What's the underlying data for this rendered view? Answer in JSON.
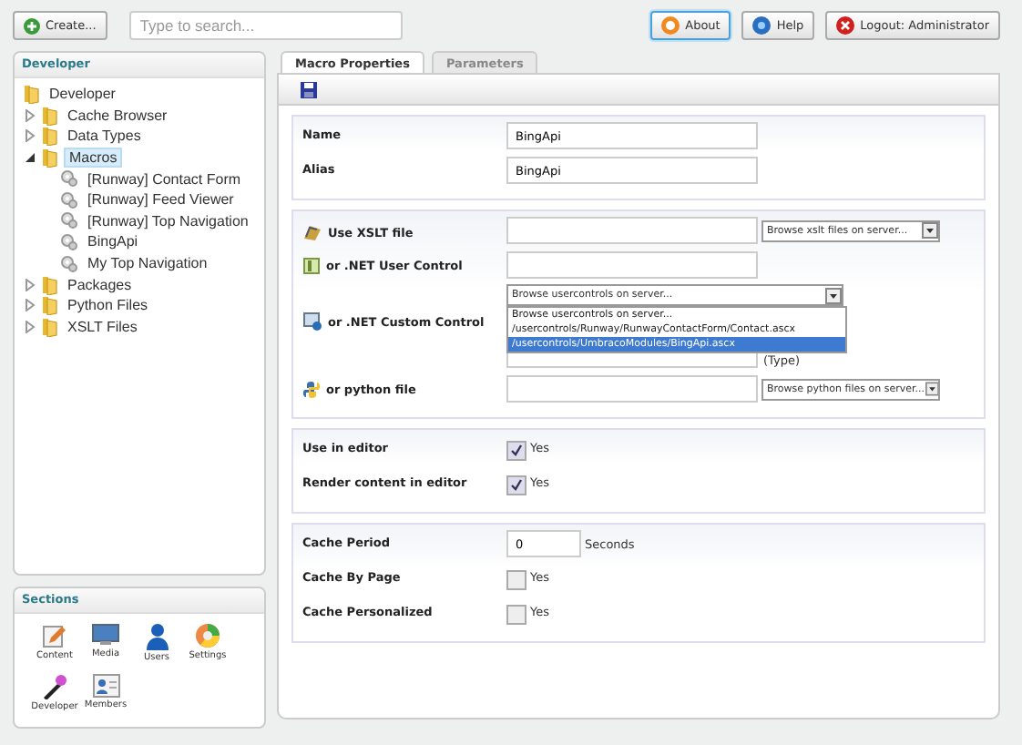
{
  "top_bar": {
    "create_button": "Create...",
    "search": {
      "placeholder": "Type to search..."
    },
    "buttons": [
      {
        "label": "About",
        "kind": "about",
        "selected": true
      },
      {
        "label": "Help",
        "kind": "help",
        "selected": false
      },
      {
        "label": "Logout: Administrator",
        "kind": "logout",
        "selected": false
      }
    ]
  },
  "tree": {
    "title": "Developer",
    "items": [
      {
        "label": "Developer",
        "kind": "folder",
        "selected": false,
        "children": [
          {
            "label": "Cache Browser",
            "kind": "folder",
            "expanded": false,
            "selected": false
          },
          {
            "label": "Data Types",
            "kind": "folder",
            "expanded": false,
            "selected": false
          },
          {
            "label": "Macros",
            "kind": "folder",
            "expanded": true,
            "selected": true,
            "children": [
              {
                "label": "[Runway] Contact Form",
                "kind": "macro",
                "selected": false
              },
              {
                "label": "[Runway] Feed Viewer",
                "kind": "macro",
                "selected": false
              },
              {
                "label": "[Runway] Top Navigation",
                "kind": "macro",
                "selected": false
              },
              {
                "label": "BingApi",
                "kind": "macro",
                "selected": false
              },
              {
                "label": "My Top Navigation",
                "kind": "macro",
                "selected": false
              }
            ]
          },
          {
            "label": "Packages",
            "kind": "folder",
            "expanded": false,
            "selected": false
          },
          {
            "label": "Python Files",
            "kind": "folder",
            "expanded": false,
            "selected": false
          },
          {
            "label": "XSLT Files",
            "kind": "folder",
            "expanded": false,
            "selected": false
          }
        ]
      }
    ]
  },
  "sections": {
    "title": "Sections",
    "items": [
      {
        "label": "Content",
        "kind": "content"
      },
      {
        "label": "Media",
        "kind": "media"
      },
      {
        "label": "Users",
        "kind": "users"
      },
      {
        "label": "Settings",
        "kind": "settings"
      },
      {
        "label": "Developer",
        "kind": "developer"
      },
      {
        "label": "Members",
        "kind": "members"
      }
    ]
  },
  "tabs": [
    {
      "label": "Macro Properties",
      "selected": true
    },
    {
      "label": "Parameters",
      "selected": false
    }
  ],
  "groups": [
    {
      "rows": [
        {
          "kind": "text",
          "label": "Name",
          "value": "BingApi"
        },
        {
          "kind": "text",
          "label": "Alias",
          "value": "BingApi"
        }
      ]
    },
    {
      "rows": [
        {
          "kind": "xslt",
          "label": "Use XSLT file",
          "browse": "Browse xslt files on server..."
        },
        {
          "kind": "usercontrol",
          "label": "or .NET User Control",
          "browse": "Browse usercontrols on server...",
          "expanded": true,
          "options": [
            {
              "label": "Browse usercontrols on server...",
              "selected": false
            },
            {
              "label": "/usercontrols/Runway/RunwayContactForm/Contact.ascx",
              "selected": false
            },
            {
              "label": "/usercontrols/UmbracoModules/BingApi.ascx",
              "selected": true
            }
          ]
        },
        {
          "kind": "custom",
          "label": "or .NET Custom Control",
          "type_label": "(Type)"
        },
        {
          "kind": "python",
          "label": "or python file",
          "browse": "Browse python files on server..."
        }
      ]
    },
    {
      "rows": [
        {
          "kind": "checkbox",
          "label": "Use in editor",
          "text": "Yes",
          "checked": true
        },
        {
          "kind": "checkbox",
          "label": "Render content in editor",
          "text": "Yes",
          "checked": true
        }
      ]
    },
    {
      "rows": [
        {
          "kind": "number",
          "label": "Cache Period",
          "value": "0",
          "unit": "Seconds"
        },
        {
          "kind": "checkbox",
          "label": "Cache By Page",
          "text": "Yes",
          "checked": false
        },
        {
          "kind": "checkbox",
          "label": "Cache Personalized",
          "text": "Yes",
          "checked": false
        }
      ]
    }
  ]
}
